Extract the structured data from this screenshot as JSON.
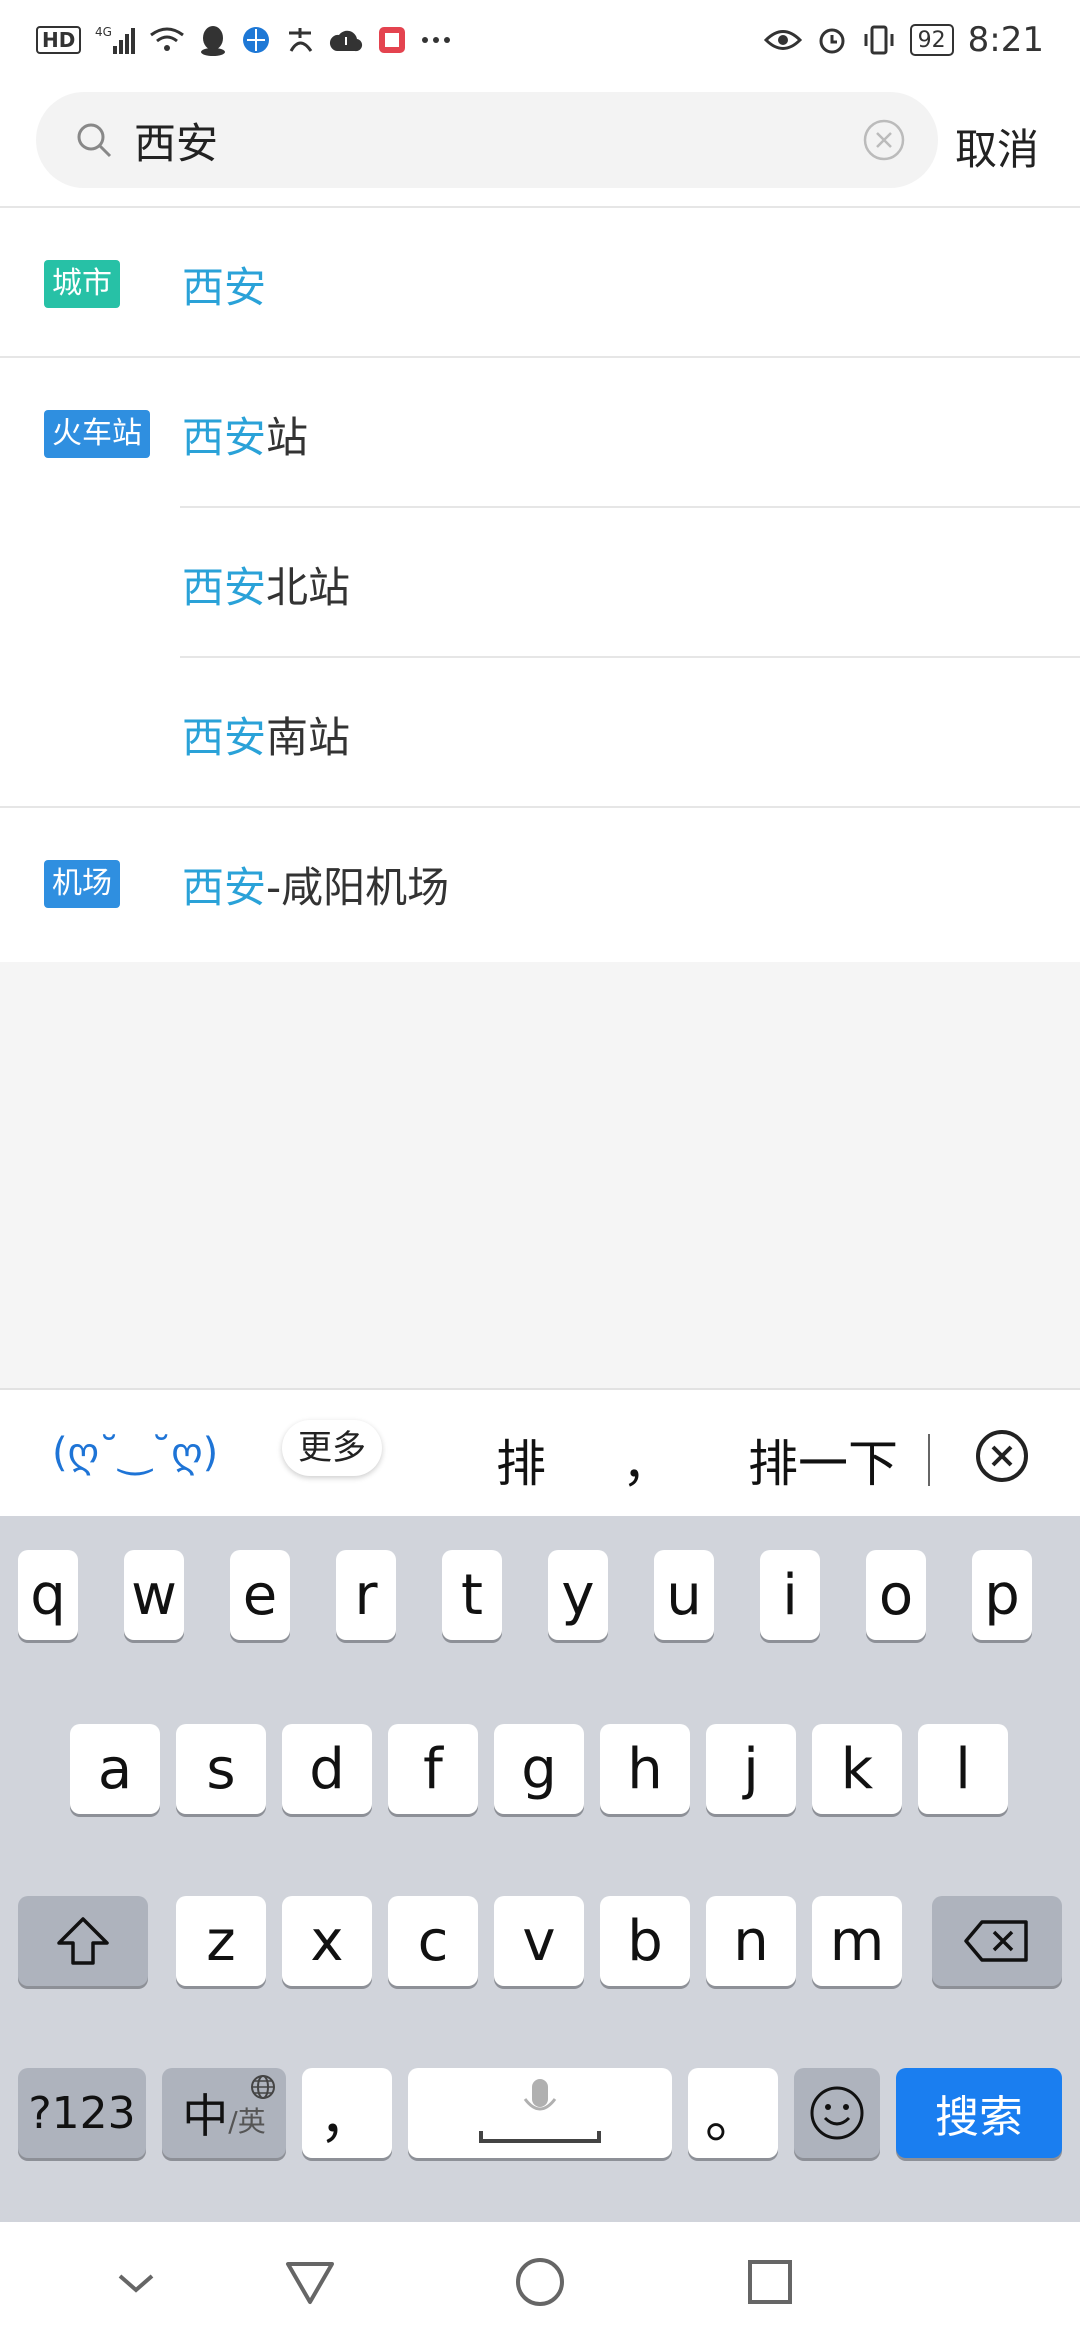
{
  "status_bar": {
    "hd": "HD",
    "network": "4G",
    "battery": "92",
    "time": "8:21"
  },
  "search": {
    "value": "西安",
    "cancel_label": "取消"
  },
  "results": [
    {
      "tag": "城市",
      "tag_color": "#27c1a6",
      "highlight": "西安",
      "suffix": ""
    },
    {
      "tag": "火车站",
      "tag_color": "#2f8fe0",
      "highlight": "西安",
      "suffix": "站"
    },
    {
      "tag": "",
      "tag_color": "",
      "highlight": "西安",
      "suffix": "北站"
    },
    {
      "tag": "",
      "tag_color": "",
      "highlight": "西安",
      "suffix": "南站"
    },
    {
      "tag": "机场",
      "tag_color": "#2f8fe0",
      "highlight": "西安",
      "suffix": "-咸阳机场"
    }
  ],
  "suggestions": {
    "kaomoji": "(ღ˘‿˘ღ)",
    "more": "更多",
    "candidates": [
      "排",
      "，",
      "排一下"
    ]
  },
  "keyboard": {
    "row1": [
      "q",
      "w",
      "e",
      "r",
      "t",
      "y",
      "u",
      "i",
      "o",
      "p"
    ],
    "row2": [
      "a",
      "s",
      "d",
      "f",
      "g",
      "h",
      "j",
      "k",
      "l"
    ],
    "row3": [
      "z",
      "x",
      "c",
      "v",
      "b",
      "n",
      "m"
    ],
    "num_key": "?123",
    "lang_main": "中",
    "lang_sub": "/英",
    "comma": "，",
    "period": "。",
    "search_key": "搜索"
  },
  "colors": {
    "highlight": "#2aa2d8",
    "accent": "#1a7ef0"
  }
}
